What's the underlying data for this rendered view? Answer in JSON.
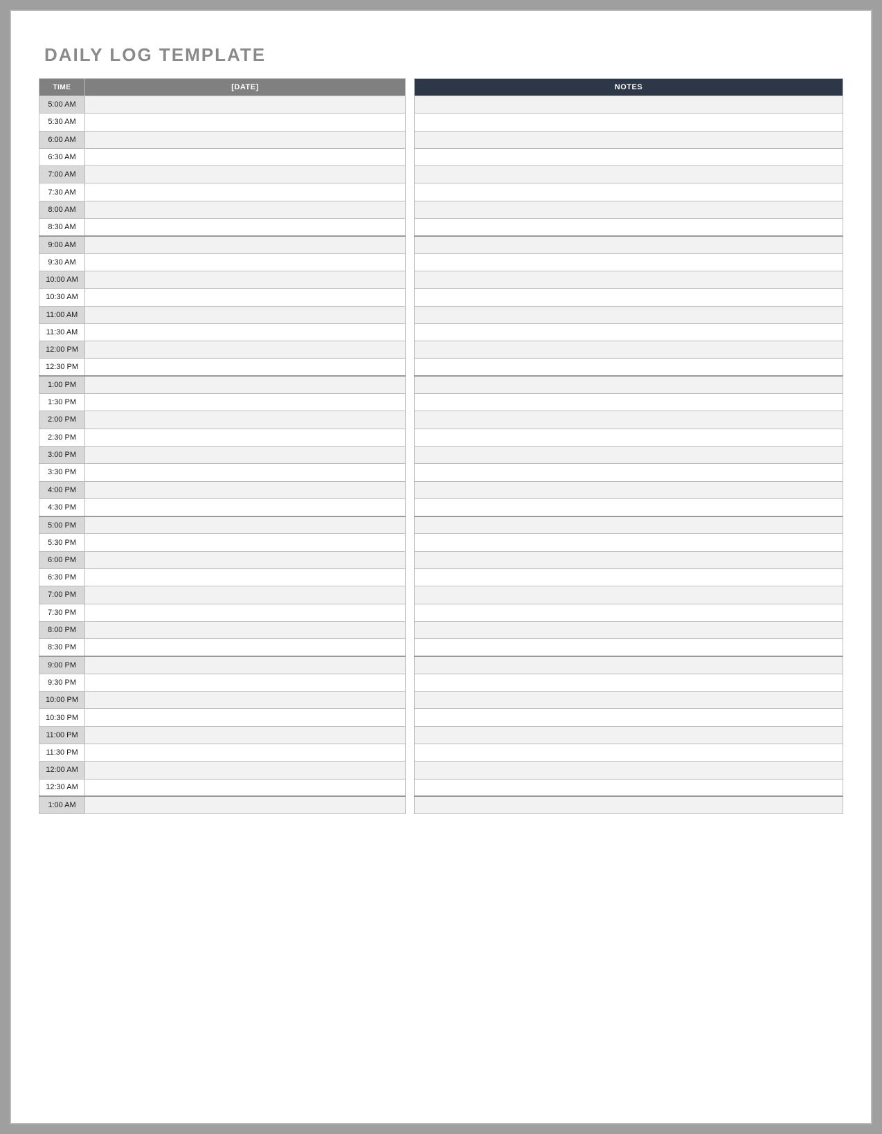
{
  "title": "DAILY LOG TEMPLATE",
  "headers": {
    "time": "TIME",
    "date": "[DATE]",
    "notes": "NOTES"
  },
  "rows": [
    {
      "time": "5:00 AM",
      "shade": true,
      "entry": "",
      "note": ""
    },
    {
      "time": "5:30 AM",
      "shade": false,
      "entry": "",
      "note": ""
    },
    {
      "time": "6:00 AM",
      "shade": true,
      "entry": "",
      "note": ""
    },
    {
      "time": "6:30 AM",
      "shade": false,
      "entry": "",
      "note": ""
    },
    {
      "time": "7:00 AM",
      "shade": true,
      "entry": "",
      "note": ""
    },
    {
      "time": "7:30 AM",
      "shade": false,
      "entry": "",
      "note": ""
    },
    {
      "time": "8:00 AM",
      "shade": true,
      "entry": "",
      "note": ""
    },
    {
      "time": "8:30 AM",
      "shade": false,
      "entry": "",
      "note": ""
    },
    {
      "time": "9:00 AM",
      "shade": true,
      "entry": "",
      "note": ""
    },
    {
      "time": "9:30 AM",
      "shade": false,
      "entry": "",
      "note": ""
    },
    {
      "time": "10:00 AM",
      "shade": true,
      "entry": "",
      "note": ""
    },
    {
      "time": "10:30 AM",
      "shade": false,
      "entry": "",
      "note": ""
    },
    {
      "time": "11:00 AM",
      "shade": true,
      "entry": "",
      "note": ""
    },
    {
      "time": "11:30 AM",
      "shade": false,
      "entry": "",
      "note": ""
    },
    {
      "time": "12:00 PM",
      "shade": true,
      "entry": "",
      "note": ""
    },
    {
      "time": "12:30 PM",
      "shade": false,
      "entry": "",
      "note": ""
    },
    {
      "time": "1:00 PM",
      "shade": true,
      "entry": "",
      "note": ""
    },
    {
      "time": "1:30 PM",
      "shade": false,
      "entry": "",
      "note": ""
    },
    {
      "time": "2:00 PM",
      "shade": true,
      "entry": "",
      "note": ""
    },
    {
      "time": "2:30 PM",
      "shade": false,
      "entry": "",
      "note": ""
    },
    {
      "time": "3:00 PM",
      "shade": true,
      "entry": "",
      "note": ""
    },
    {
      "time": "3:30 PM",
      "shade": false,
      "entry": "",
      "note": ""
    },
    {
      "time": "4:00 PM",
      "shade": true,
      "entry": "",
      "note": ""
    },
    {
      "time": "4:30 PM",
      "shade": false,
      "entry": "",
      "note": ""
    },
    {
      "time": "5:00 PM",
      "shade": true,
      "entry": "",
      "note": ""
    },
    {
      "time": "5:30 PM",
      "shade": false,
      "entry": "",
      "note": ""
    },
    {
      "time": "6:00 PM",
      "shade": true,
      "entry": "",
      "note": ""
    },
    {
      "time": "6:30 PM",
      "shade": false,
      "entry": "",
      "note": ""
    },
    {
      "time": "7:00 PM",
      "shade": true,
      "entry": "",
      "note": ""
    },
    {
      "time": "7:30 PM",
      "shade": false,
      "entry": "",
      "note": ""
    },
    {
      "time": "8:00 PM",
      "shade": true,
      "entry": "",
      "note": ""
    },
    {
      "time": "8:30 PM",
      "shade": false,
      "entry": "",
      "note": ""
    },
    {
      "time": "9:00 PM",
      "shade": true,
      "entry": "",
      "note": ""
    },
    {
      "time": "9:30 PM",
      "shade": false,
      "entry": "",
      "note": ""
    },
    {
      "time": "10:00 PM",
      "shade": true,
      "entry": "",
      "note": ""
    },
    {
      "time": "10:30 PM",
      "shade": false,
      "entry": "",
      "note": ""
    },
    {
      "time": "11:00 PM",
      "shade": true,
      "entry": "",
      "note": ""
    },
    {
      "time": "11:30 PM",
      "shade": false,
      "entry": "",
      "note": ""
    },
    {
      "time": "12:00 AM",
      "shade": true,
      "entry": "",
      "note": ""
    },
    {
      "time": "12:30 AM",
      "shade": false,
      "entry": "",
      "note": ""
    },
    {
      "time": "1:00 AM",
      "shade": true,
      "entry": "",
      "note": ""
    }
  ]
}
